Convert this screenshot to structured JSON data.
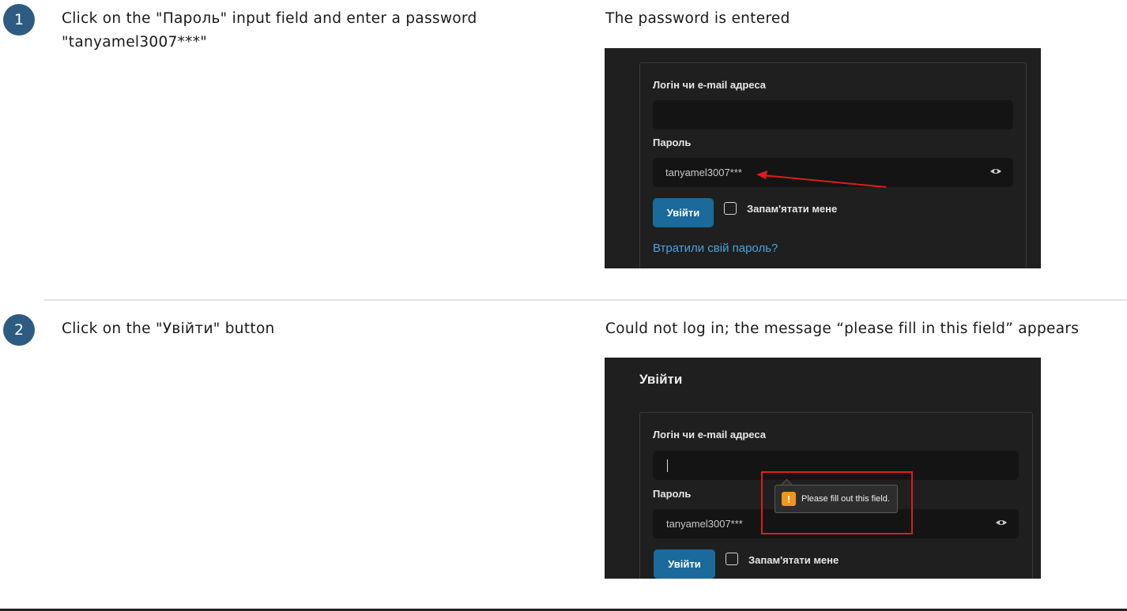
{
  "steps": [
    {
      "number": "1",
      "action": "Click on the \"Пароль\" input field and enter a password \"tanyamel3007***\"",
      "result": "The password is entered"
    },
    {
      "number": "2",
      "action": "Click on the \"Увійти\" button",
      "result": "Could not log in; the message “please fill in this field” appears"
    }
  ],
  "screenshot1": {
    "login_label": "Логін чи e-mail адреса",
    "login_value": "",
    "password_label": "Пароль",
    "password_value": "tanyamel3007***",
    "submit_label": "Увійти",
    "remember_label": "Запам'ятати мене",
    "forgot_link": "Втратили свій пароль?"
  },
  "screenshot2": {
    "heading": "Увійти",
    "login_label": "Логін чи e-mail адреса",
    "login_value": "",
    "password_label": "Пароль",
    "password_value": "tanyamel3007***",
    "tooltip_text": "Please fill out this field.",
    "submit_label": "Увійти",
    "remember_label": "Запам'ятати мене"
  },
  "colors": {
    "badge": "#2e5b82",
    "app_bg": "#1f1f1f",
    "button": "#1b6a9b",
    "link": "#4aa3df",
    "highlight": "#e01b1b",
    "warning": "#f0961b"
  },
  "icons": [
    "eye-icon",
    "warning-icon",
    "checkbox",
    "arrow-annotation"
  ]
}
